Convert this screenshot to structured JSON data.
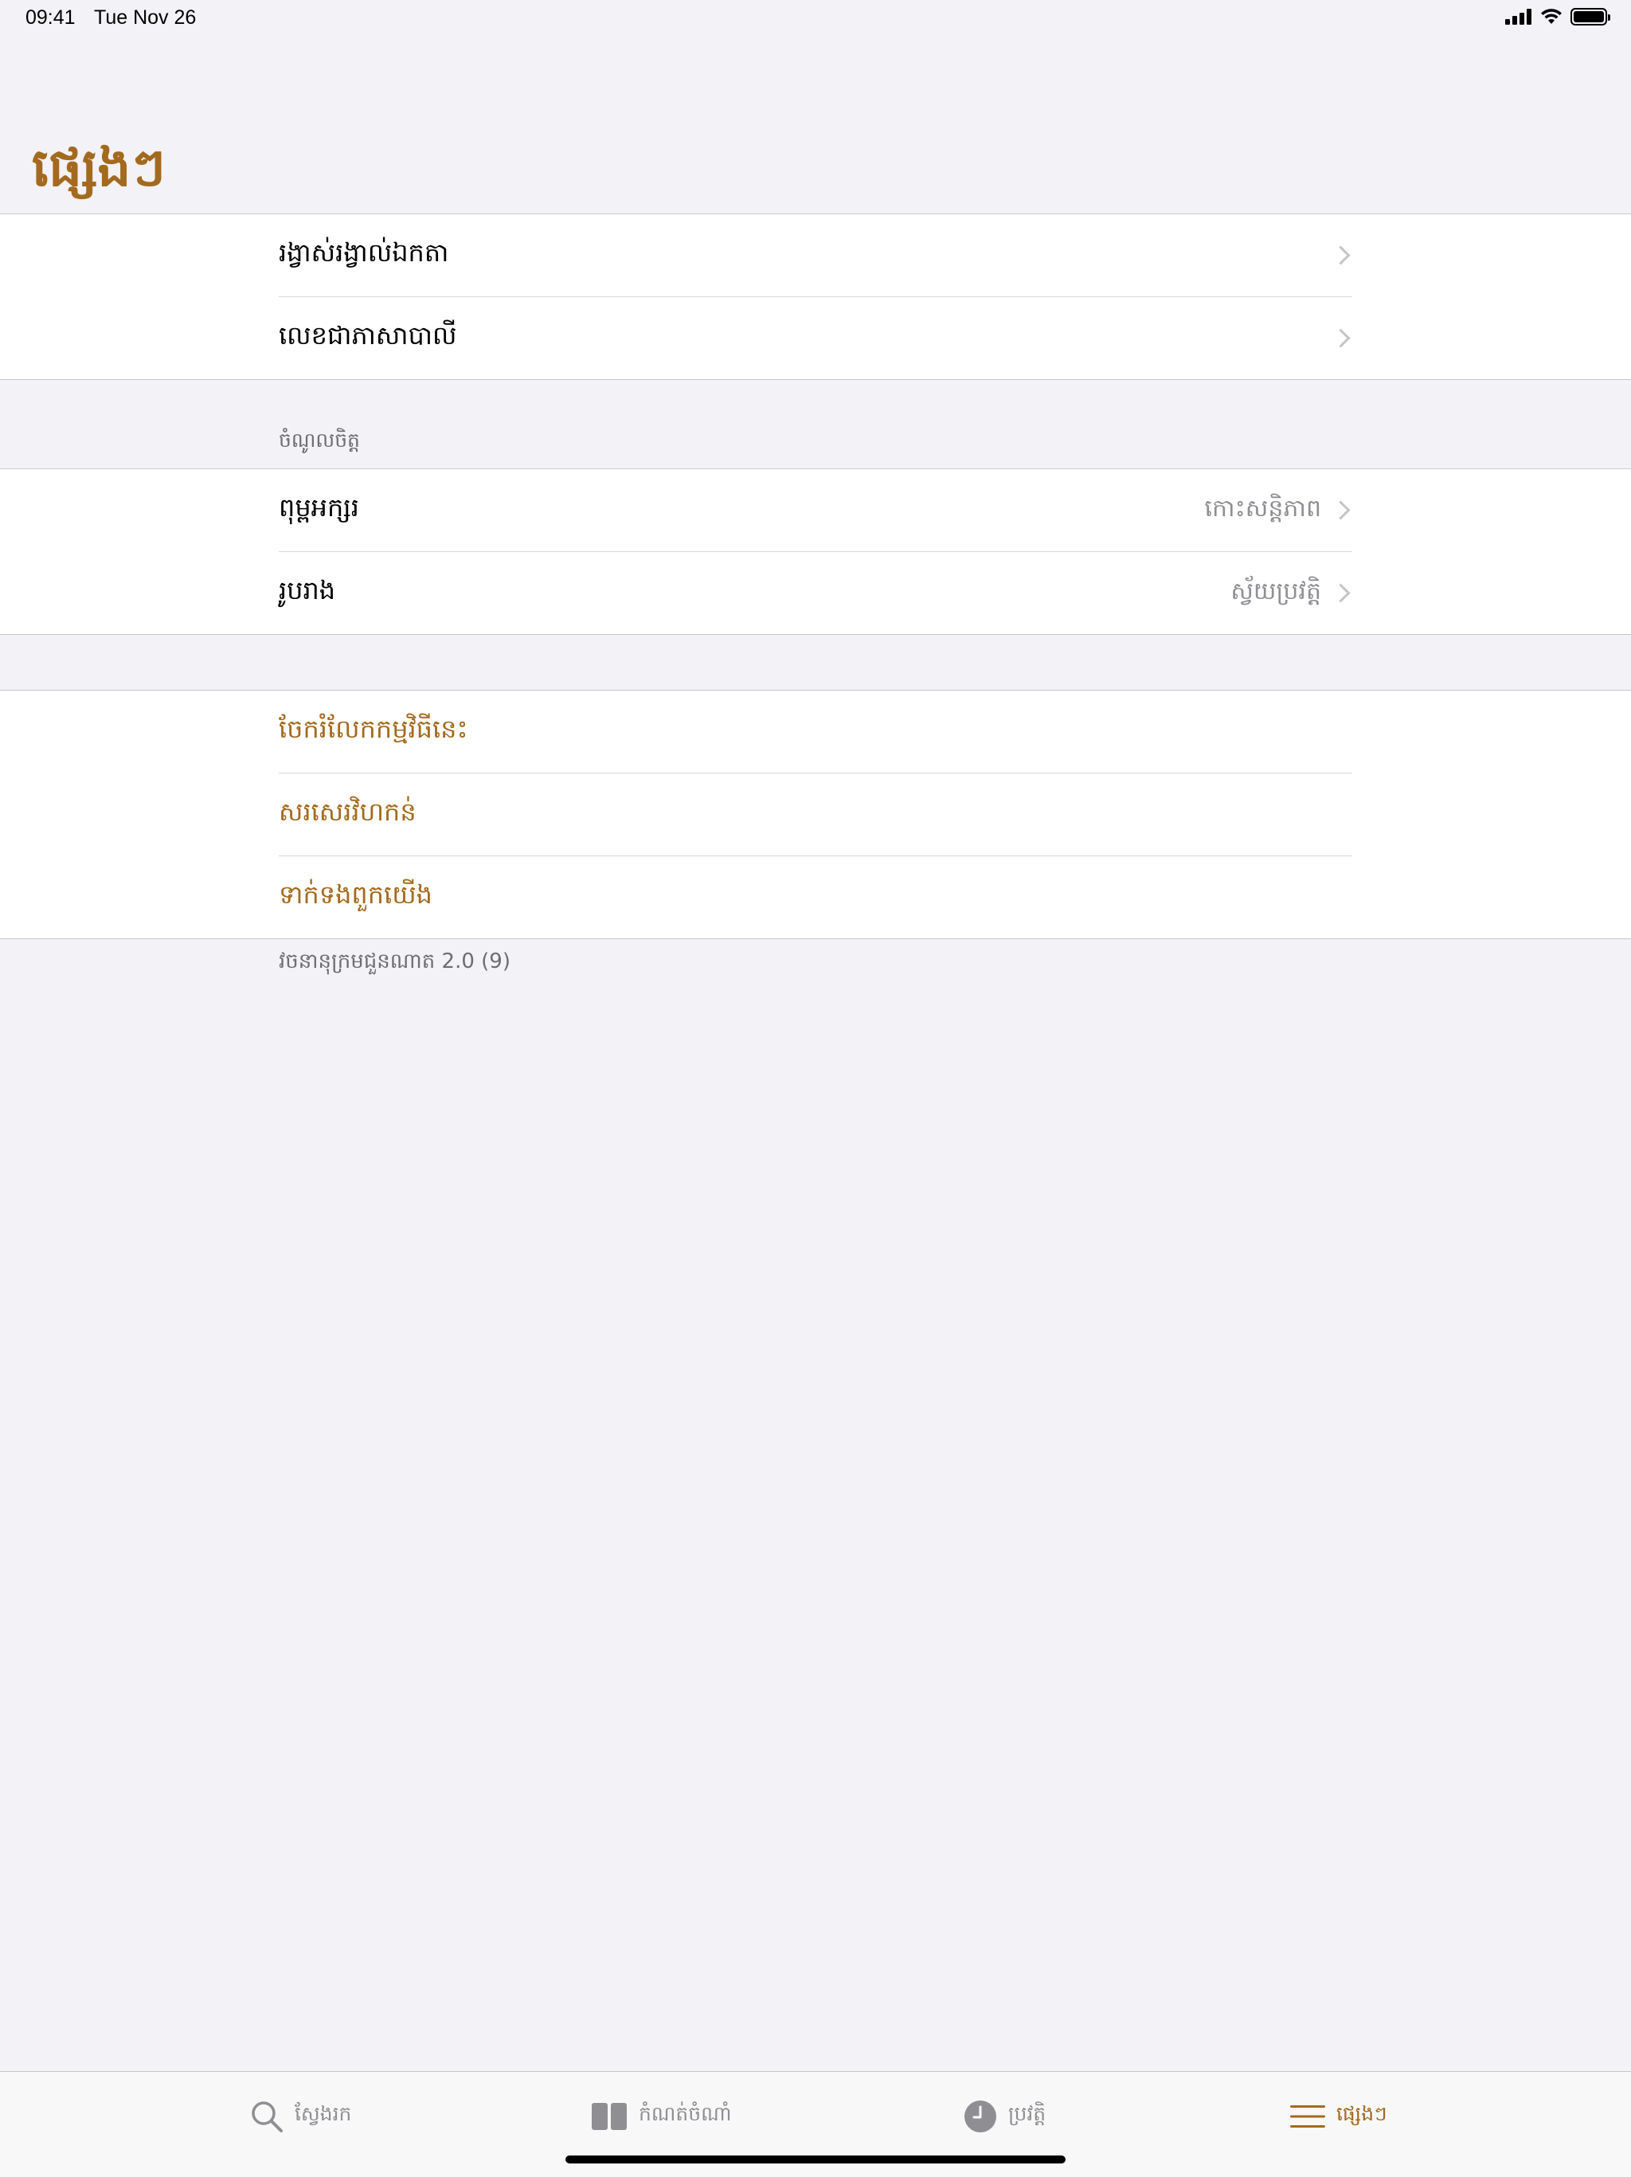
{
  "status_bar": {
    "time": "09:41",
    "date": "Tue Nov 26"
  },
  "header": {
    "title": "ផ្សេងៗ"
  },
  "group1": {
    "items": [
      {
        "label": "រង្វាស់រង្វាល់ឯកតា"
      },
      {
        "label": "លេខជាភាសាបាលី"
      }
    ]
  },
  "preferences": {
    "header": "ចំណូលចិត្ត",
    "items": [
      {
        "label": "ពុម្ពអក្សរ",
        "value": "កោះសន្តិភាព"
      },
      {
        "label": "រូបរាង",
        "value": "ស្វ័យប្រវត្តិ"
      }
    ]
  },
  "actions": {
    "items": [
      {
        "label": "ចែករំលែកកម្មវិធីនេះ"
      },
      {
        "label": "សរសេរវិហកន់"
      },
      {
        "label": "ទាក់ទងពួកយើង"
      }
    ]
  },
  "footer": {
    "version_text": "វចនានុក្រមជួនណាត 2.0 (9)"
  },
  "tab_bar": {
    "tabs": [
      {
        "label": "ស្វែងរក",
        "icon": "search-icon"
      },
      {
        "label": "កំណត់ចំណាំ",
        "icon": "book-icon"
      },
      {
        "label": "ប្រវត្តិ",
        "icon": "clock-icon"
      },
      {
        "label": "ផ្សេងៗ",
        "icon": "menu-icon",
        "active": true
      }
    ]
  },
  "colors": {
    "accent": "#a36a1f",
    "background": "#f2f2f7",
    "secondary_text": "#8e8e93"
  }
}
